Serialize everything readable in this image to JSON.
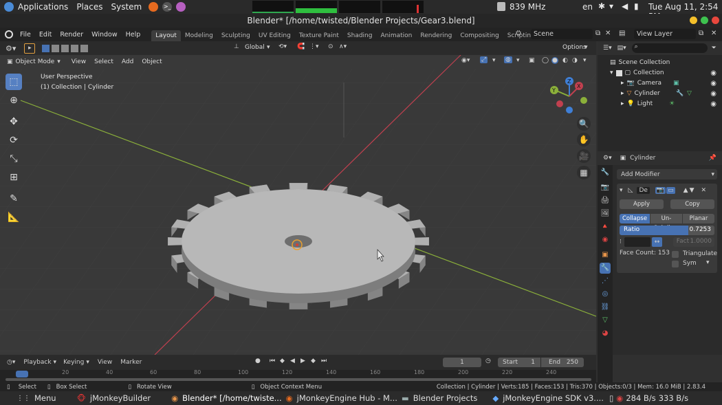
{
  "os_bar": {
    "applications": "Applications",
    "places": "Places",
    "system": "System",
    "cpu_freq": "839 MHz",
    "locale": "en",
    "datetime": "Tue Aug 11,  2:54 PM"
  },
  "window": {
    "title": "Blender* [/home/twisted/Blender Projects/Gear3.blend]"
  },
  "menubar": {
    "items": [
      "File",
      "Edit",
      "Render",
      "Window",
      "Help"
    ],
    "workspaces": [
      "Layout",
      "Modeling",
      "Sculpting",
      "UV Editing",
      "Texture Paint",
      "Shading",
      "Animation",
      "Rendering",
      "Compositing",
      "Scripting"
    ],
    "scene": "Scene",
    "view_layer": "View Layer"
  },
  "viewport": {
    "mode": "Object Mode",
    "menus": [
      "View",
      "Select",
      "Add",
      "Object"
    ],
    "orientation": "Global",
    "options": "Options",
    "overlay_title": "User Perspective",
    "overlay_subtitle": "(1) Collection | Cylinder",
    "gizmo_z": "Z",
    "gizmo_y": "Y",
    "gizmo_x": "X"
  },
  "outliner": {
    "search_placeholder": "",
    "rows": [
      {
        "label": "Scene Collection"
      },
      {
        "label": "Collection"
      },
      {
        "label": "Camera"
      },
      {
        "label": "Cylinder"
      },
      {
        "label": "Light"
      }
    ]
  },
  "properties": {
    "object_name": "Cylinder",
    "add_modifier": "Add Modifier",
    "modifier_name": "De",
    "apply": "Apply",
    "copy": "Copy",
    "mode_collapse": "Collapse",
    "mode_unsubdiv": "Un-Subdiv...",
    "mode_planar": "Planar",
    "ratio_label": "Ratio",
    "ratio_value": "0.7253",
    "ratio_fraction": 0.7253,
    "factor_label": "Fact",
    "factor_value": "1.0000",
    "face_count": "Face Count: 153",
    "triangulate": "Triangulate",
    "sym": "Sym"
  },
  "timeline": {
    "playback": "Playback",
    "keying": "Keying",
    "view": "View",
    "marker": "Marker",
    "current_frame": "1",
    "start_label": "Start",
    "start_value": "1",
    "end_label": "End",
    "end_value": "250",
    "ruler_ticks": [
      "0",
      "20",
      "40",
      "60",
      "80",
      "100",
      "120",
      "140",
      "160",
      "180",
      "200",
      "220",
      "240"
    ]
  },
  "statusbar": {
    "select": "Select",
    "box_select": "Box Select",
    "rotate_view": "Rotate View",
    "context_menu": "Object Context Menu",
    "stats": "Collection | Cylinder | Verts:185 | Faces:153 | Tris:370 | Objects:0/3 | Mem: 16.0 MiB | 2.83.4"
  },
  "taskbar": {
    "menu": "Menu",
    "tasks": [
      "jMonkeyBuilder",
      "Blender* [/home/twiste...",
      "jMonkeyEngine Hub - M...",
      "Blender Projects",
      "jMonkeyEngine SDK v3...."
    ],
    "net_down": "284 B/s",
    "net_up": "333 B/s"
  },
  "colors": {
    "accent_blue": "#4772b3",
    "active_tool": "#5680c2",
    "x_axis": "#c0404f",
    "y_axis": "#8bb03a",
    "z_axis": "#3f7fd6",
    "gear": "#b5b5b5"
  }
}
